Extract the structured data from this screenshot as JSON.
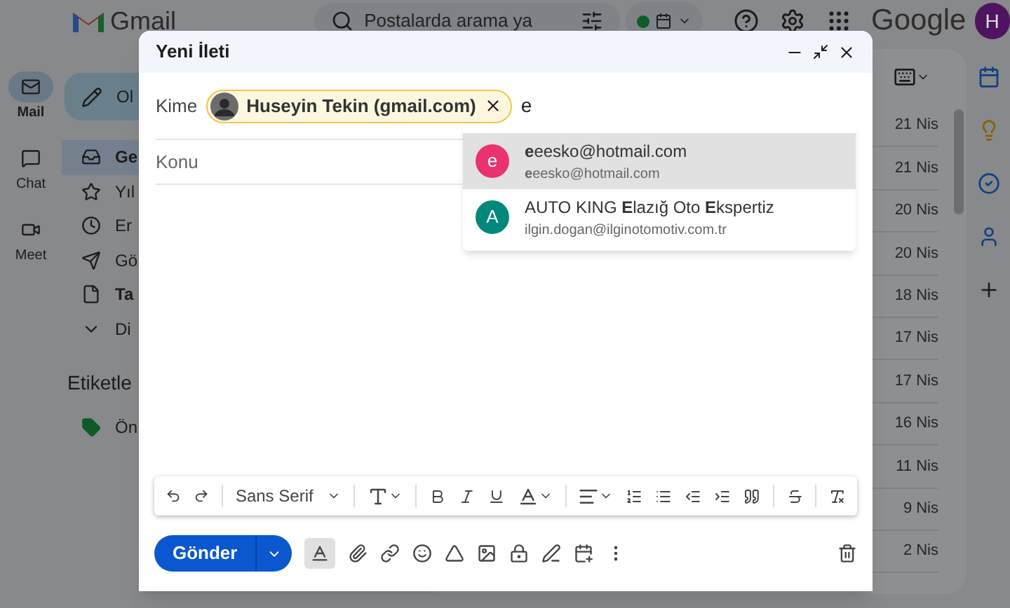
{
  "topbar": {
    "logo_text": "Gmail",
    "search": {
      "placeholder": "Postalarda arama ya"
    },
    "status": {
      "color": "#0c5e25"
    },
    "brand": "Google",
    "avatar": "H"
  },
  "rail": [
    {
      "label": "Mail",
      "selected": true
    },
    {
      "label": "Chat",
      "selected": false
    },
    {
      "label": "Meet",
      "selected": false
    }
  ],
  "sidebar": {
    "compose": "Ol",
    "items": [
      {
        "label": "Ge",
        "selected": true,
        "bold": true
      },
      {
        "label": "Yıl",
        "selected": false,
        "bold": false
      },
      {
        "label": "Er",
        "selected": false,
        "bold": false
      },
      {
        "label": "Gö",
        "selected": false,
        "bold": false
      },
      {
        "label": "Ta",
        "selected": false,
        "bold": true
      },
      {
        "label": "Di",
        "selected": false,
        "bold": false
      }
    ],
    "labels_heading": "Etiketle",
    "labels": [
      {
        "label": "Ön",
        "color": "#0e5b2a"
      }
    ]
  },
  "mail_dates": [
    "21 Nis",
    "21 Nis",
    "20 Nis",
    "20 Nis",
    "18 Nis",
    "17 Nis",
    "17 Nis",
    "16 Nis",
    "11 Nis",
    "9 Nis",
    "2 Nis"
  ],
  "compose": {
    "title": "Yeni İleti",
    "to_label": "Kime",
    "recipients": [
      {
        "name": "Huseyin Tekin (gmail.com)"
      }
    ],
    "typed": "e",
    "subject": {
      "placeholder": "Konu"
    },
    "suggestions": [
      {
        "initial": "e",
        "color": "#e8336f",
        "name": "**e**eesko@hotmail.com",
        "email": "**e**eesko@hotmail.com",
        "selected": true
      },
      {
        "initial": "A",
        "color": "#00897b",
        "name": "AUTO KING **E**lazığ Oto **E**kspertiz",
        "email": "ilgin.dogan@ilginotomotiv.com.tr",
        "selected": false
      }
    ],
    "font": "Sans Serif",
    "send": "Gönder",
    "formatting_selected": true
  }
}
